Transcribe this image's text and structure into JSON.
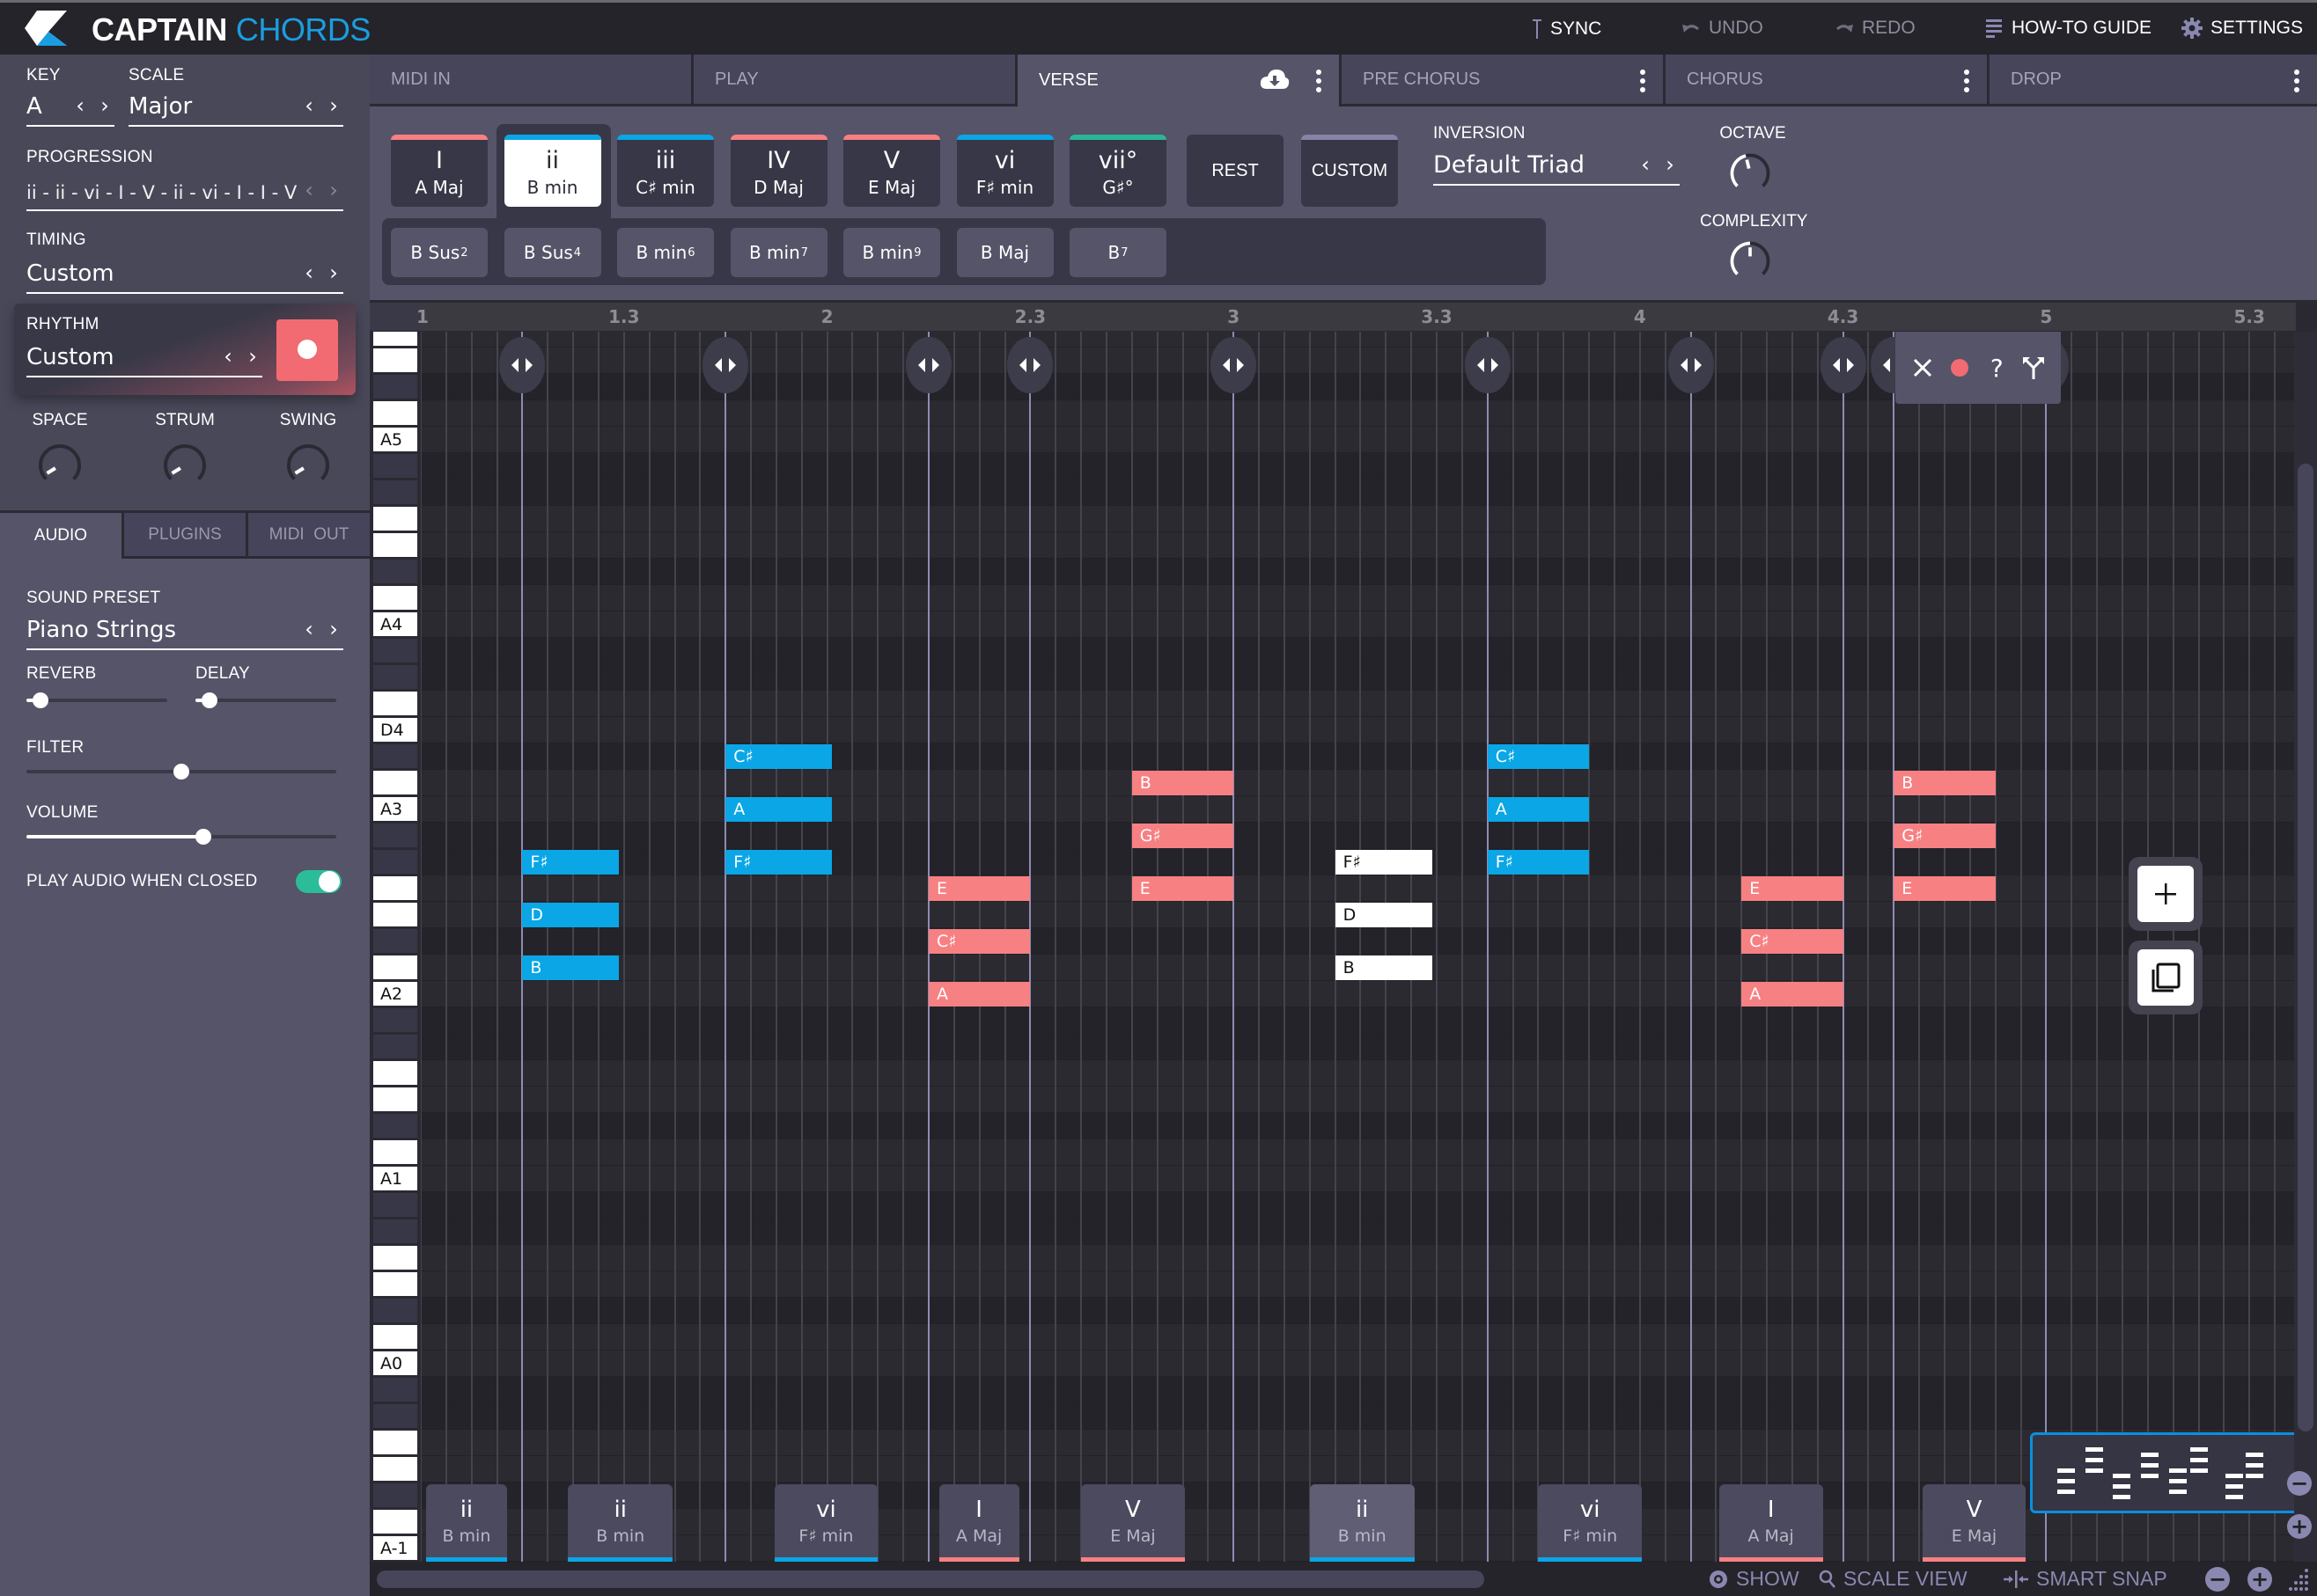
{
  "app": {
    "brand_primary": "CAPTAIN",
    "brand_secondary": "CHORDS",
    "brand_color": "#1a9ee0"
  },
  "header": {
    "buttons": [
      {
        "id": "sync",
        "label": "SYNC",
        "icon": "sync-marker-icon",
        "enabled": true
      },
      {
        "id": "undo",
        "label": "UNDO",
        "icon": "undo-icon",
        "enabled": false
      },
      {
        "id": "redo",
        "label": "REDO",
        "icon": "redo-icon",
        "enabled": false
      },
      {
        "id": "guide",
        "label": "HOW-TO GUIDE",
        "icon": "list-icon",
        "enabled": true
      },
      {
        "id": "settings",
        "label": "SETTINGS",
        "icon": "gear-icon",
        "enabled": true
      }
    ]
  },
  "sidebar": {
    "key": {
      "label": "KEY",
      "value": "A"
    },
    "scale": {
      "label": "SCALE",
      "value": "Major"
    },
    "progression": {
      "label": "PROGRESSION",
      "value": "ii - ii - vi - I - V - ii - vi - I - I - V"
    },
    "timing": {
      "label": "TIMING",
      "value": "Custom"
    },
    "rhythm": {
      "label": "RHYTHM",
      "value": "Custom",
      "record_active": true
    },
    "knobs": [
      {
        "label": "SPACE",
        "value": 0.05
      },
      {
        "label": "STRUM",
        "value": 0.05
      },
      {
        "label": "SWING",
        "value": 0.05
      }
    ],
    "tabs": [
      {
        "label": "AUDIO",
        "active": true
      },
      {
        "label": "PLUGINS",
        "active": false
      },
      {
        "label": "MIDI  OUT",
        "active": false
      }
    ],
    "audio": {
      "sound_preset_label": "SOUND PRESET",
      "sound_preset": "Piano Strings",
      "reverb_label": "REVERB",
      "reverb": 0.1,
      "delay_label": "DELAY",
      "delay": 0.1,
      "filter_label": "FILTER",
      "filter": 0.5,
      "volume_label": "VOLUME",
      "volume": 0.57,
      "play_when_closed_label": "PLAY AUDIO WHEN CLOSED",
      "play_when_closed": true
    }
  },
  "section_tabs": [
    {
      "label": "MIDI IN",
      "active": false,
      "menu": false,
      "cloud": false
    },
    {
      "label": "PLAY",
      "active": false,
      "menu": false,
      "cloud": false
    },
    {
      "label": "VERSE",
      "active": true,
      "menu": true,
      "cloud": true
    },
    {
      "label": "PRE CHORUS",
      "active": false,
      "menu": true,
      "cloud": false
    },
    {
      "label": "CHORUS",
      "active": false,
      "menu": true,
      "cloud": false
    },
    {
      "label": "DROP",
      "active": false,
      "menu": true,
      "cloud": false
    }
  ],
  "chord_palette": {
    "degrees": [
      {
        "numeral": "I",
        "name": "A Maj",
        "color": "#f78083",
        "selected": false
      },
      {
        "numeral": "ii",
        "name": "B min",
        "color": "#0aa6e6",
        "selected": true
      },
      {
        "numeral": "iii",
        "name": "C♯ min",
        "color": "#0aa6e6",
        "selected": false
      },
      {
        "numeral": "IV",
        "name": "D Maj",
        "color": "#f78083",
        "selected": false
      },
      {
        "numeral": "V",
        "name": "E Maj",
        "color": "#f78083",
        "selected": false
      },
      {
        "numeral": "vi",
        "name": "F♯ min",
        "color": "#0aa6e6",
        "selected": false
      },
      {
        "numeral": "vii°",
        "name": "G♯°",
        "color": "#2bb796",
        "selected": false
      }
    ],
    "rest_label": "REST",
    "custom_label": "CUSTOM",
    "custom_color": "#8683a8",
    "variations": [
      {
        "base": "B Sus",
        "sup": "2"
      },
      {
        "base": "B Sus",
        "sup": "4"
      },
      {
        "base": "B min",
        "sup": "6"
      },
      {
        "base": "B min",
        "sup": "7"
      },
      {
        "base": "B min",
        "sup": "9"
      },
      {
        "base": "B Maj",
        "sup": ""
      },
      {
        "base": "B",
        "sup": "7"
      }
    ],
    "inversion_label": "INVERSION",
    "inversion": "Default Triad",
    "octave_label": "OCTAVE",
    "octave": 0.45,
    "complexity_label": "COMPLEXITY",
    "complexity": 0.5
  },
  "piano_roll": {
    "ruler_ticks": [
      "1",
      "1.3",
      "2",
      "2.3",
      "3",
      "3.3",
      "4",
      "4.3",
      "5",
      "5.3"
    ],
    "key_labels": [
      "A5",
      "A4",
      "D4",
      "A3",
      "A2",
      "A1",
      "A0",
      "A-1"
    ],
    "scale_rows_top_to_bottom": [
      "E6",
      "D6",
      "C#6",
      "B5",
      "A5",
      "G#5",
      "F#5",
      "E5",
      "D5",
      "C#5",
      "B4",
      "A4",
      "G#4",
      "F#4",
      "E4",
      "D4",
      "C#4",
      "B3",
      "A3",
      "G#3",
      "F#3",
      "E3",
      "D3",
      "C#3",
      "B2",
      "A2",
      "G#2",
      "F#2",
      "E2",
      "D2",
      "C#2",
      "B1",
      "A1",
      "G#1",
      "F#1",
      "E1",
      "D1",
      "C#1",
      "B0",
      "A0",
      "G#0",
      "F#0",
      "E0",
      "D0",
      "C#0",
      "B-1",
      "A-1"
    ],
    "row_key_shading": {
      "A": "w",
      "B": "w",
      "C#": "d",
      "D": "w",
      "E": "w",
      "F#": "d",
      "G#": "d"
    },
    "notes": [
      {
        "label": "F♯",
        "pitch": "F#3",
        "start": 1,
        "length": 0.95,
        "color": "blue"
      },
      {
        "label": "D",
        "pitch": "D3",
        "start": 1,
        "length": 0.95,
        "color": "blue"
      },
      {
        "label": "B",
        "pitch": "B2",
        "start": 1,
        "length": 0.95,
        "color": "blue"
      },
      {
        "label": "C♯",
        "pitch": "C#4",
        "start": 3,
        "length": 1.05,
        "color": "blue"
      },
      {
        "label": "A",
        "pitch": "A3",
        "start": 3,
        "length": 1.05,
        "color": "blue"
      },
      {
        "label": "F♯",
        "pitch": "F#3",
        "start": 3,
        "length": 1.05,
        "color": "blue"
      },
      {
        "label": "E",
        "pitch": "E3",
        "start": 5,
        "length": 1.0,
        "color": "red"
      },
      {
        "label": "C♯",
        "pitch": "C#3",
        "start": 5,
        "length": 1.0,
        "color": "red"
      },
      {
        "label": "A",
        "pitch": "A2",
        "start": 5,
        "length": 1.0,
        "color": "red"
      },
      {
        "label": "B",
        "pitch": "B3",
        "start": 7,
        "length": 1.0,
        "color": "red"
      },
      {
        "label": "G♯",
        "pitch": "G#3",
        "start": 7,
        "length": 1.0,
        "color": "red"
      },
      {
        "label": "E",
        "pitch": "E3",
        "start": 7,
        "length": 1.0,
        "color": "red"
      },
      {
        "label": "F♯",
        "pitch": "F#3",
        "start": 9,
        "length": 0.96,
        "color": "white"
      },
      {
        "label": "D",
        "pitch": "D3",
        "start": 9,
        "length": 0.96,
        "color": "white"
      },
      {
        "label": "B",
        "pitch": "B2",
        "start": 9,
        "length": 0.96,
        "color": "white"
      },
      {
        "label": "C♯",
        "pitch": "C#4",
        "start": 10.5,
        "length": 1.0,
        "color": "blue"
      },
      {
        "label": "A",
        "pitch": "A3",
        "start": 10.5,
        "length": 1.0,
        "color": "blue"
      },
      {
        "label": "F♯",
        "pitch": "F#3",
        "start": 10.5,
        "length": 1.0,
        "color": "blue"
      },
      {
        "label": "E",
        "pitch": "E3",
        "start": 13,
        "length": 1.0,
        "color": "red"
      },
      {
        "label": "C♯",
        "pitch": "C#3",
        "start": 13,
        "length": 1.0,
        "color": "red"
      },
      {
        "label": "A",
        "pitch": "A2",
        "start": 13,
        "length": 1.0,
        "color": "red"
      },
      {
        "label": "B",
        "pitch": "B3",
        "start": 14.5,
        "length": 1.0,
        "color": "red"
      },
      {
        "label": "G♯",
        "pitch": "G#3",
        "start": 14.5,
        "length": 1.0,
        "color": "red"
      },
      {
        "label": "E",
        "pitch": "E3",
        "start": 14.5,
        "length": 1.0,
        "color": "red"
      }
    ],
    "chord_boundaries": [
      1,
      3,
      5,
      6,
      8,
      10.5,
      12.5,
      14,
      14.5,
      16
    ],
    "handles": [
      1,
      3,
      5,
      6,
      8,
      10.5,
      12.5,
      14
    ],
    "popup": {
      "at": 14.5,
      "actions": [
        "close",
        "record",
        "help",
        "split"
      ]
    },
    "chord_strip": [
      {
        "numeral": "ii",
        "name": "B min",
        "start": 0.05,
        "length": 0.8,
        "color": "#0aa6e6",
        "selected": false
      },
      {
        "numeral": "ii",
        "name": "B min",
        "start": 1.45,
        "length": 1.03,
        "color": "#0aa6e6",
        "selected": false
      },
      {
        "numeral": "vi",
        "name": "F♯ min",
        "start": 3.48,
        "length": 1.02,
        "color": "#0aa6e6",
        "selected": false
      },
      {
        "numeral": "I",
        "name": "A Maj",
        "start": 5.1,
        "length": 0.79,
        "color": "#f78083",
        "selected": false
      },
      {
        "numeral": "V",
        "name": "E Maj",
        "start": 6.5,
        "length": 1.02,
        "color": "#f78083",
        "selected": false
      },
      {
        "numeral": "ii",
        "name": "B min",
        "start": 8.75,
        "length": 1.03,
        "color": "#0aa6e6",
        "selected": true
      },
      {
        "numeral": "vi",
        "name": "F♯ min",
        "start": 11.0,
        "length": 1.02,
        "color": "#0aa6e6",
        "selected": false
      },
      {
        "numeral": "I",
        "name": "A Maj",
        "start": 12.78,
        "length": 1.02,
        "color": "#f78083",
        "selected": false
      },
      {
        "numeral": "V",
        "name": "E Maj",
        "start": 14.78,
        "length": 1.02,
        "color": "#f78083",
        "selected": false
      }
    ]
  },
  "bottom_bar": {
    "show_label": "SHOW",
    "scale_view_label": "SCALE VIEW",
    "smart_snap_label": "SMART SNAP"
  }
}
